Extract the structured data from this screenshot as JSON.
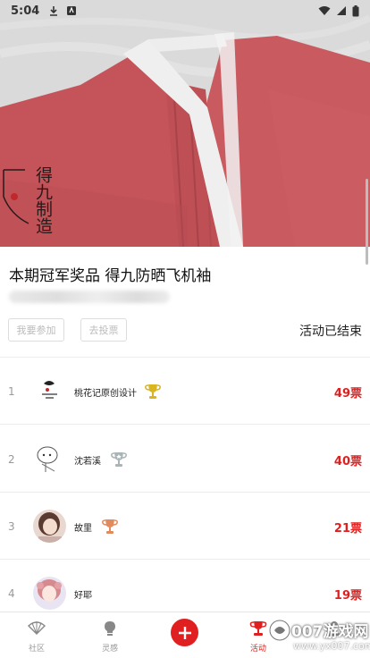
{
  "status_bar": {
    "time": "5:04"
  },
  "activity": {
    "title": "本期冠军奖品 得九防晒飞机袖",
    "join_button": "我要参加",
    "vote_button": "去投票",
    "status": "活动已结束",
    "seal_text": "得九制造"
  },
  "ranking": [
    {
      "rank": "1",
      "name": "桃花记原创设计",
      "votes": "49票",
      "trophy": "gold"
    },
    {
      "rank": "2",
      "name": "沈若溪",
      "votes": "40票",
      "trophy": "silver"
    },
    {
      "rank": "3",
      "name": "故里",
      "votes": "21票",
      "trophy": "bronze"
    },
    {
      "rank": "4",
      "name": "好耶",
      "votes": "19票",
      "trophy": ""
    }
  ],
  "nav": {
    "items": [
      {
        "label": "社区",
        "icon": "fan-icon"
      },
      {
        "label": "灵感",
        "icon": "lightbulb-icon"
      },
      {
        "label": "",
        "icon": "plus-icon"
      },
      {
        "label": "活动",
        "icon": "trophy-icon"
      },
      {
        "label": "",
        "icon": "profile-icon"
      }
    ]
  },
  "watermark": {
    "text": "007游戏网",
    "url": "www.yx007.com"
  },
  "colors": {
    "accent": "#e02020",
    "gold": "#d9b51f",
    "silver": "#a9b4b6",
    "bronze": "#e08a5e",
    "garment": "#c8585c"
  }
}
